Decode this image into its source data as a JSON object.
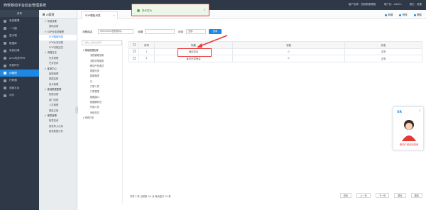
{
  "app": {
    "title": "西软移动平台后台管理系统",
    "top_right": [
      "客户名称：西软新管理组",
      "用户名：admin",
      "退出 · 设置"
    ]
  },
  "sidebar": {
    "top_label": "菜单",
    "items": [
      {
        "label": "系统管理"
      },
      {
        "label": "一卡通"
      },
      {
        "label": "显示端"
      },
      {
        "label": "数据库"
      },
      {
        "label": "系统边域"
      },
      {
        "label": "pms系统PMS"
      },
      {
        "label": "系统时行"
      },
      {
        "label": "AI管理"
      },
      {
        "label": "扫码通"
      },
      {
        "label": "测度平台"
      },
      {
        "label": "评价"
      }
    ],
    "active_index": 7
  },
  "panel2": {
    "header": "AI管理",
    "rows": [
      {
        "label": "系统设置",
        "type": "group"
      },
      {
        "label": "基础设置",
        "type": "item"
      },
      {
        "label": "SOP业务流管理",
        "type": "group"
      },
      {
        "label": "SOP模板列表",
        "type": "item",
        "active": true
      },
      {
        "label": "SOP业务流程",
        "type": "item"
      },
      {
        "label": "SOP流程监控",
        "type": "item"
      },
      {
        "label": "流程日志",
        "type": "group"
      },
      {
        "label": "任务管理",
        "type": "item"
      },
      {
        "label": "任务查询",
        "type": "item"
      },
      {
        "label": "客单中心",
        "type": "group"
      },
      {
        "label": "客服管理",
        "type": "item"
      },
      {
        "label": "数据监管",
        "type": "item"
      },
      {
        "label": "技术管理",
        "type": "item"
      },
      {
        "label": "基础数据配置",
        "type": "group"
      },
      {
        "label": "权限设置",
        "type": "item"
      },
      {
        "label": "部门设置",
        "type": "item"
      },
      {
        "label": "人员管理",
        "type": "item"
      },
      {
        "label": "模板注册",
        "type": "item"
      },
      {
        "label": "报表管理",
        "type": "group"
      },
      {
        "label": "报表查询",
        "type": "item"
      },
      {
        "label": "报表导入记录",
        "type": "item"
      },
      {
        "label": "报表数据分析",
        "type": "item"
      }
    ]
  },
  "tabbar": {
    "tab_label": "SOP模板列表",
    "actions": [
      "新增",
      "修改",
      "删除"
    ]
  },
  "toast": {
    "text": "操作成功"
  },
  "filters": {
    "label_group": "流程组名",
    "group_value": "H0000000西软移动...",
    "label_title": "标题",
    "label_status": "状态",
    "status_value": "全部",
    "query_button": "查询"
  },
  "tree": {
    "search_placeholder": "请输入搜索关键字",
    "rows": [
      {
        "label": "基础数据配置",
        "type": "root"
      },
      {
        "label": "流程管理设置",
        "type": "child"
      },
      {
        "label": "流程字段配置",
        "type": "child"
      },
      {
        "label": "移动产品调试",
        "type": "child"
      },
      {
        "label": "数据分类",
        "type": "child"
      },
      {
        "label": "数据权限",
        "type": "child"
      },
      {
        "label": "行",
        "type": "child"
      },
      {
        "label": "门禁人员",
        "type": "child"
      },
      {
        "label": "门禁权限",
        "type": "child"
      },
      {
        "label": "数据接口",
        "type": "child"
      },
      {
        "label": "数据解析出",
        "type": "child"
      },
      {
        "label": "外部人员",
        "type": "child"
      },
      {
        "label": "系统日志",
        "type": "child"
      },
      {
        "label": "系统日志",
        "type": "leaf"
      }
    ]
  },
  "table": {
    "headers": [
      "",
      "序号",
      "标题",
      "流程",
      "状态"
    ],
    "rows": [
      {
        "index": "1",
        "title": "酒店前台",
        "flow": "0",
        "status": "正常"
      },
      {
        "index": "2",
        "title": "每日代表例会",
        "flow": "0",
        "status": "正常"
      }
    ]
  },
  "footer": {
    "summary": "共有 2 条 当前第 1/1 页 每页显示 20 条",
    "pager": [
      "首页",
      "上一页",
      "下一页",
      "尾页",
      "跳转"
    ]
  },
  "promo": {
    "logo": "XR",
    "text": "移动产品在线咨询"
  }
}
